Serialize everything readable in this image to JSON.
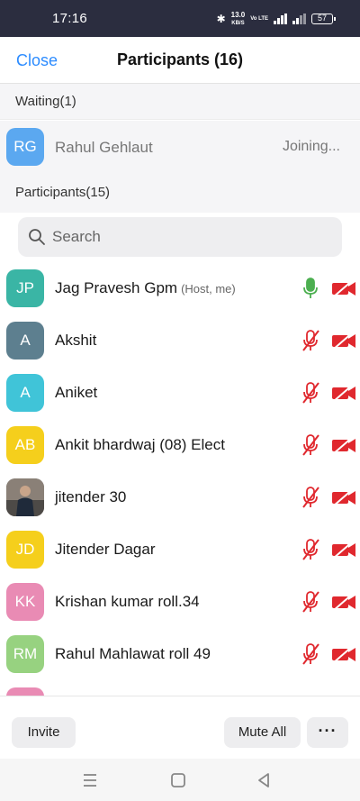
{
  "status_bar": {
    "time": "17:16",
    "net_speed": "13.0",
    "net_unit": "KB/S",
    "volte": "Vo LTE",
    "battery": "57",
    "icons": [
      "bluetooth-icon",
      "signal-icon",
      "battery-icon"
    ]
  },
  "header": {
    "close_label": "Close",
    "title": "Participants (16)"
  },
  "waiting": {
    "label": "Waiting(1)",
    "person": {
      "initials": "RG",
      "name": "Rahul Gehlaut",
      "status": "Joining...",
      "color": "#5ba8f0"
    }
  },
  "participants": {
    "label": "Participants(15)",
    "search_placeholder": "Search",
    "rows": [
      {
        "initials": "JP",
        "name": "Jag Pravesh Gpm",
        "tag": "(Host, me)",
        "color": "#3ab5a5",
        "mic": "on",
        "cam": "off"
      },
      {
        "initials": "A",
        "name": "Akshit",
        "tag": "",
        "color": "#5d7f8f",
        "mic": "muted",
        "cam": "off"
      },
      {
        "initials": "A",
        "name": "Aniket",
        "tag": "",
        "color": "#40c4d8",
        "mic": "muted",
        "cam": "off"
      },
      {
        "initials": "AB",
        "name": "Ankit bhardwaj (08) Elect",
        "tag": "",
        "color": "#f5cf1c",
        "mic": "muted",
        "cam": "off"
      },
      {
        "initials": "",
        "name": "jitender 30",
        "tag": "",
        "color": "#6c6a66",
        "photo": true,
        "mic": "muted",
        "cam": "off"
      },
      {
        "initials": "JD",
        "name": "Jitender Dagar",
        "tag": "",
        "color": "#f5cf1c",
        "mic": "muted",
        "cam": "off"
      },
      {
        "initials": "KK",
        "name": "Krishan kumar roll.34",
        "tag": "",
        "color": "#e98bb4",
        "mic": "muted",
        "cam": "off"
      },
      {
        "initials": "RM",
        "name": "Rahul Mahlawat roll 49",
        "tag": "",
        "color": "#97d280",
        "mic": "muted",
        "cam": "off"
      },
      {
        "initials": "",
        "name": "",
        "tag": "",
        "color": "#e98bb4",
        "mic": "muted",
        "cam": "off"
      }
    ]
  },
  "footer": {
    "invite_label": "Invite",
    "mute_all_label": "Mute All",
    "more_label": "···"
  },
  "colors": {
    "accent": "#2d8cff",
    "mic_on": "#4caf50",
    "muted": "#e0282e"
  }
}
